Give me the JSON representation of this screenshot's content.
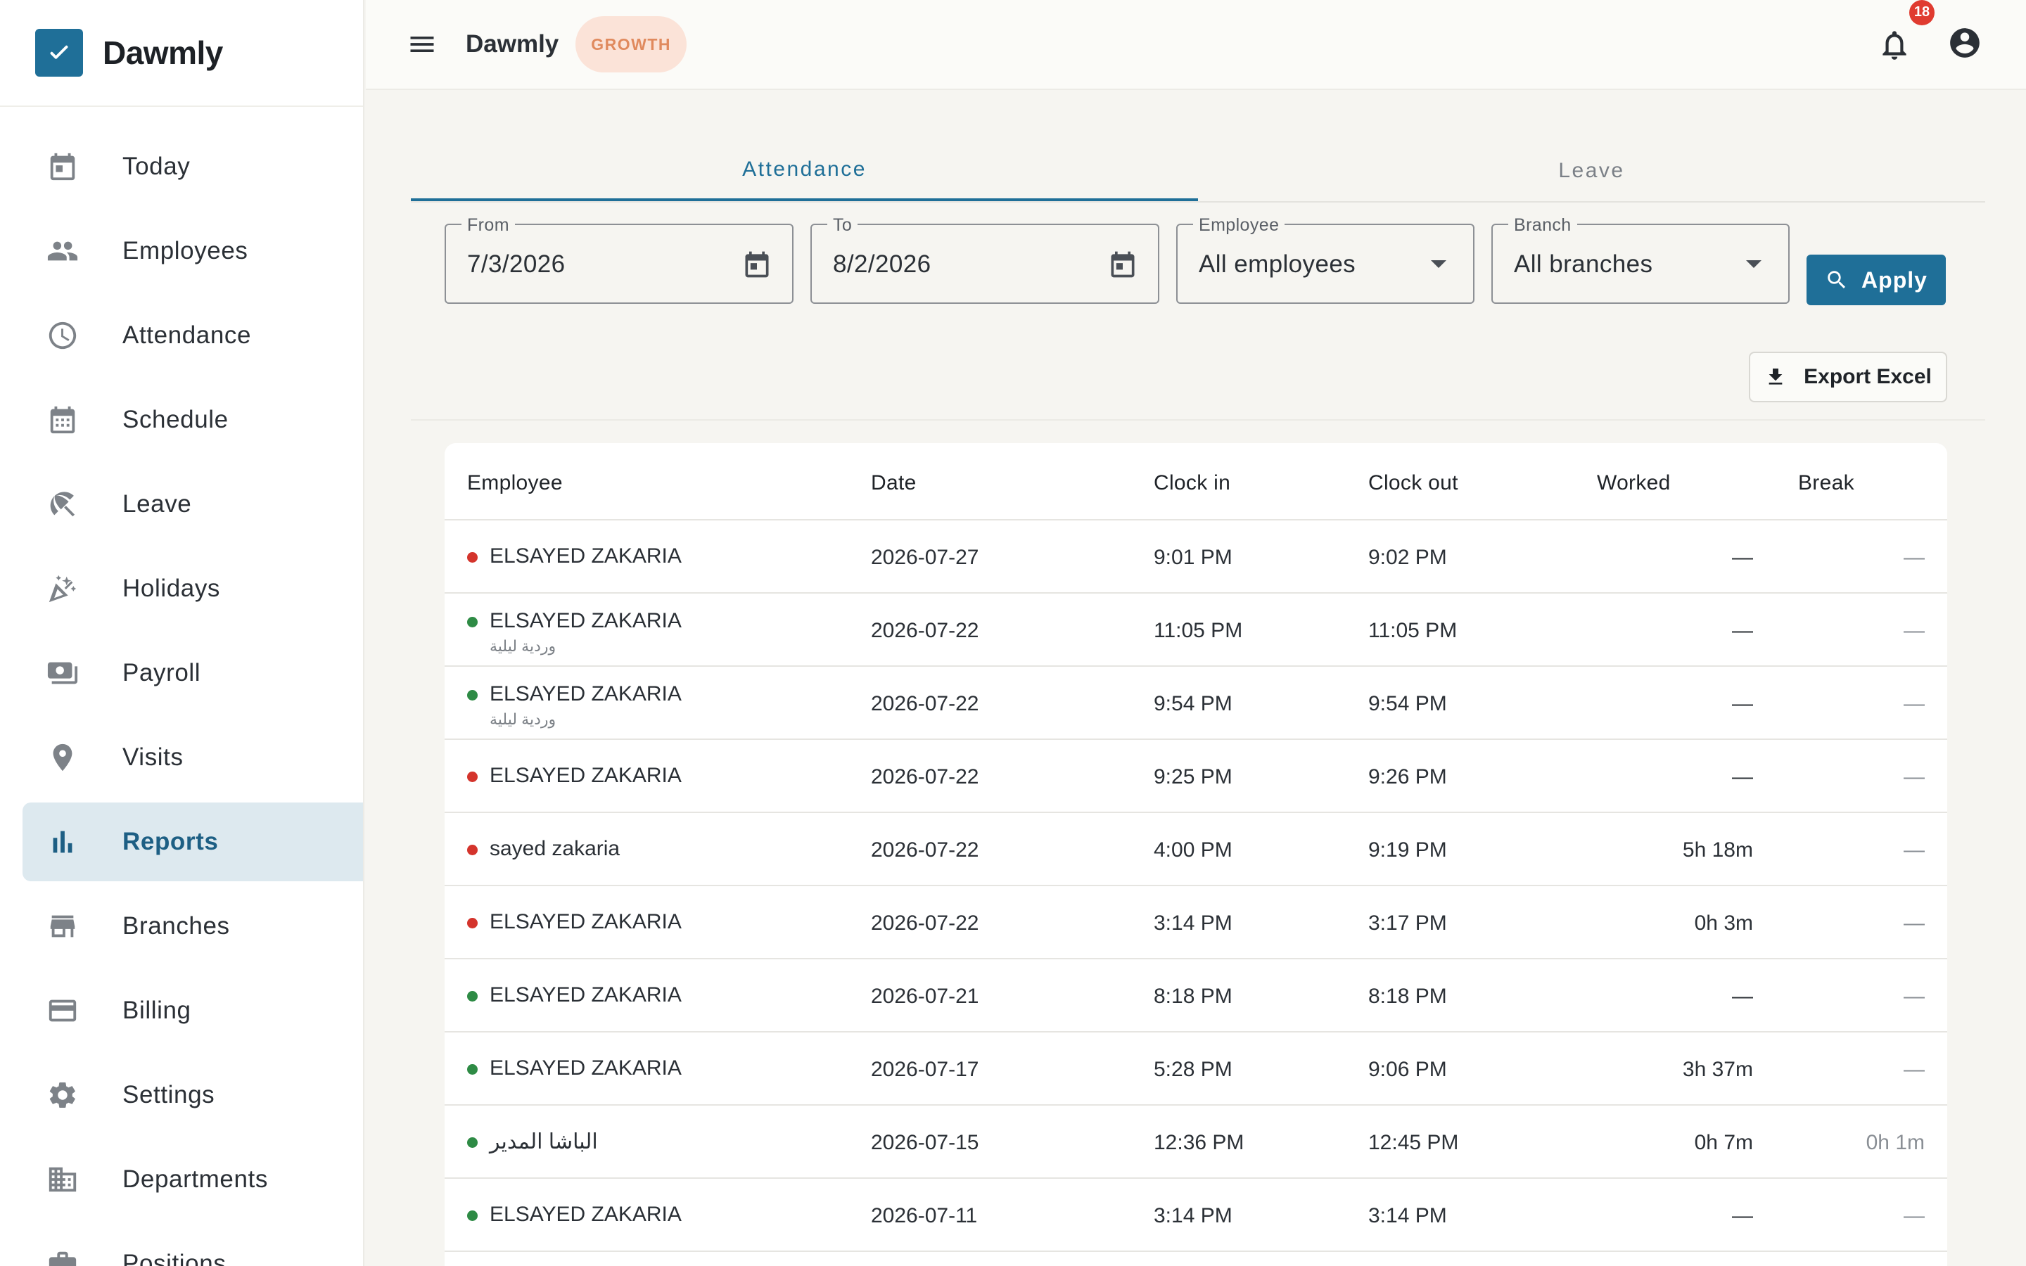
{
  "app": {
    "name": "Dawmly",
    "plan": "GROWTH",
    "notifications": "18"
  },
  "sidebar": {
    "items": [
      {
        "label": "Today",
        "icon": "calendar-today-icon"
      },
      {
        "label": "Employees",
        "icon": "people-icon"
      },
      {
        "label": "Attendance",
        "icon": "clock-icon"
      },
      {
        "label": "Schedule",
        "icon": "calendar-grid-icon"
      },
      {
        "label": "Leave",
        "icon": "beach-umbrella-icon"
      },
      {
        "label": "Holidays",
        "icon": "party-popper-icon"
      },
      {
        "label": "Payroll",
        "icon": "money-icon"
      },
      {
        "label": "Visits",
        "icon": "location-pin-icon"
      },
      {
        "label": "Reports",
        "icon": "bar-chart-icon",
        "active": true
      },
      {
        "label": "Branches",
        "icon": "store-icon"
      },
      {
        "label": "Billing",
        "icon": "credit-card-icon"
      },
      {
        "label": "Settings",
        "icon": "gear-icon"
      },
      {
        "label": "Departments",
        "icon": "building-icon"
      },
      {
        "label": "Positions",
        "icon": "briefcase-icon"
      }
    ]
  },
  "tabs": [
    {
      "label": "Attendance",
      "active": true
    },
    {
      "label": "Leave",
      "active": false
    }
  ],
  "filters": {
    "from": {
      "label": "From",
      "value": "7/3/2026"
    },
    "to": {
      "label": "To",
      "value": "8/2/2026"
    },
    "employee": {
      "label": "Employee",
      "value": "All employees"
    },
    "branch": {
      "label": "Branch",
      "value": "All branches"
    },
    "apply_label": "Apply"
  },
  "export_label": "Export Excel",
  "table": {
    "columns": [
      "Employee",
      "Date",
      "Clock in",
      "Clock out",
      "Worked",
      "Break"
    ],
    "rows": [
      {
        "status": "red",
        "name": "ELSAYED ZAKARIA",
        "sub": "",
        "date": "2026-07-27",
        "in": "9:01 PM",
        "out": "9:02 PM",
        "worked": "—",
        "break": "—"
      },
      {
        "status": "green",
        "name": "ELSAYED ZAKARIA",
        "sub": "وردية ليلية",
        "date": "2026-07-22",
        "in": "11:05 PM",
        "out": "11:05 PM",
        "worked": "—",
        "break": "—"
      },
      {
        "status": "green",
        "name": "ELSAYED ZAKARIA",
        "sub": "وردية ليلية",
        "date": "2026-07-22",
        "in": "9:54 PM",
        "out": "9:54 PM",
        "worked": "—",
        "break": "—"
      },
      {
        "status": "red",
        "name": "ELSAYED ZAKARIA",
        "sub": "",
        "date": "2026-07-22",
        "in": "9:25 PM",
        "out": "9:26 PM",
        "worked": "—",
        "break": "—"
      },
      {
        "status": "red",
        "name": "sayed zakaria",
        "sub": "",
        "date": "2026-07-22",
        "in": "4:00 PM",
        "out": "9:19 PM",
        "worked": "5h 18m",
        "break": "—"
      },
      {
        "status": "red",
        "name": "ELSAYED ZAKARIA",
        "sub": "",
        "date": "2026-07-22",
        "in": "3:14 PM",
        "out": "3:17 PM",
        "worked": "0h 3m",
        "break": "—"
      },
      {
        "status": "green",
        "name": "ELSAYED ZAKARIA",
        "sub": "",
        "date": "2026-07-21",
        "in": "8:18 PM",
        "out": "8:18 PM",
        "worked": "—",
        "break": "—"
      },
      {
        "status": "green",
        "name": "ELSAYED ZAKARIA",
        "sub": "",
        "date": "2026-07-17",
        "in": "5:28 PM",
        "out": "9:06 PM",
        "worked": "3h 37m",
        "break": "—"
      },
      {
        "status": "green",
        "name": "الباشا المدير",
        "sub": "",
        "date": "2026-07-15",
        "in": "12:36 PM",
        "out": "12:45 PM",
        "worked": "0h 7m",
        "break": "0h 1m"
      },
      {
        "status": "green",
        "name": "ELSAYED ZAKARIA",
        "sub": "",
        "date": "2026-07-11",
        "in": "3:14 PM",
        "out": "3:14 PM",
        "worked": "—",
        "break": "—"
      }
    ]
  },
  "colors": {
    "accent": "#1f6f98",
    "status_red": "#d4342c",
    "status_green": "#2e8b45",
    "badge_bg": "#fbe3d8",
    "badge_text": "#e08a5e"
  }
}
